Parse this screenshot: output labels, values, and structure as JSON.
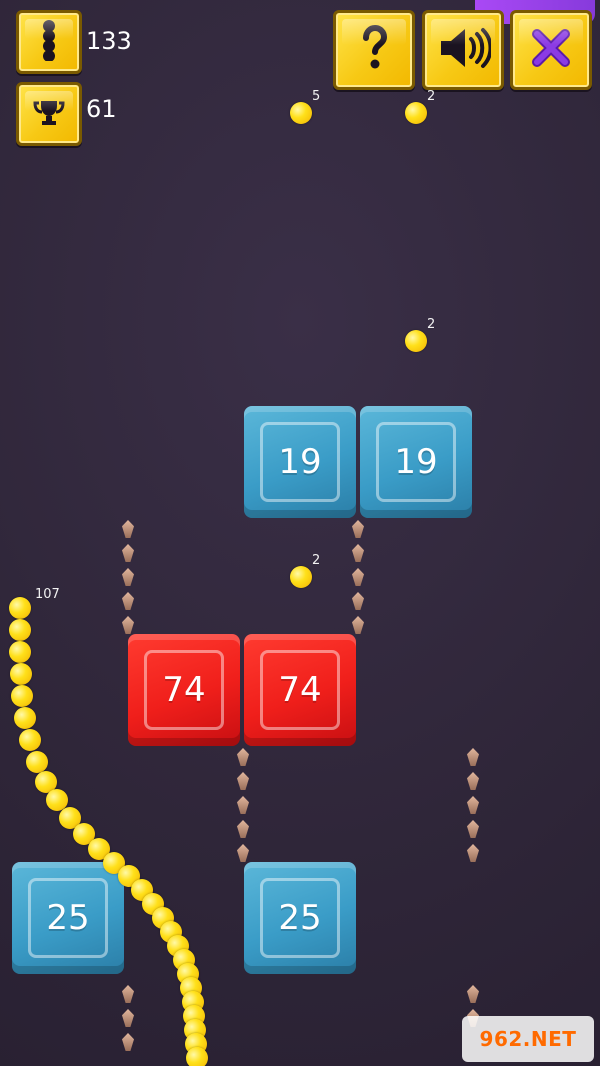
{
  "hud": {
    "score": "133",
    "best": "61",
    "buttons": {
      "help_icon": "question-icon",
      "sound_icon": "speaker-icon",
      "close_icon": "close-icon",
      "score_icon": "snake-icon",
      "best_icon": "trophy-icon"
    }
  },
  "coins": [
    {
      "value": "5"
    },
    {
      "value": "2"
    },
    {
      "value": "2"
    },
    {
      "value": "2"
    }
  ],
  "blocks": [
    {
      "value": "19",
      "color": "#3a9cc7"
    },
    {
      "value": "19",
      "color": "#3a9cc7"
    },
    {
      "value": "74",
      "color": "#f01f1b"
    },
    {
      "value": "74",
      "color": "#f01f1b"
    },
    {
      "value": "25",
      "color": "#3a9cc7"
    },
    {
      "value": "25",
      "color": "#3a9cc7"
    }
  ],
  "snake": {
    "length": "107",
    "color": "#ffe01a"
  },
  "watermark": {
    "text": "962.NET"
  },
  "colors": {
    "accent_yellow": "#f7c915",
    "background": "#2f2639",
    "block_blue": "#3a9cc7",
    "block_red": "#f01f1b"
  }
}
